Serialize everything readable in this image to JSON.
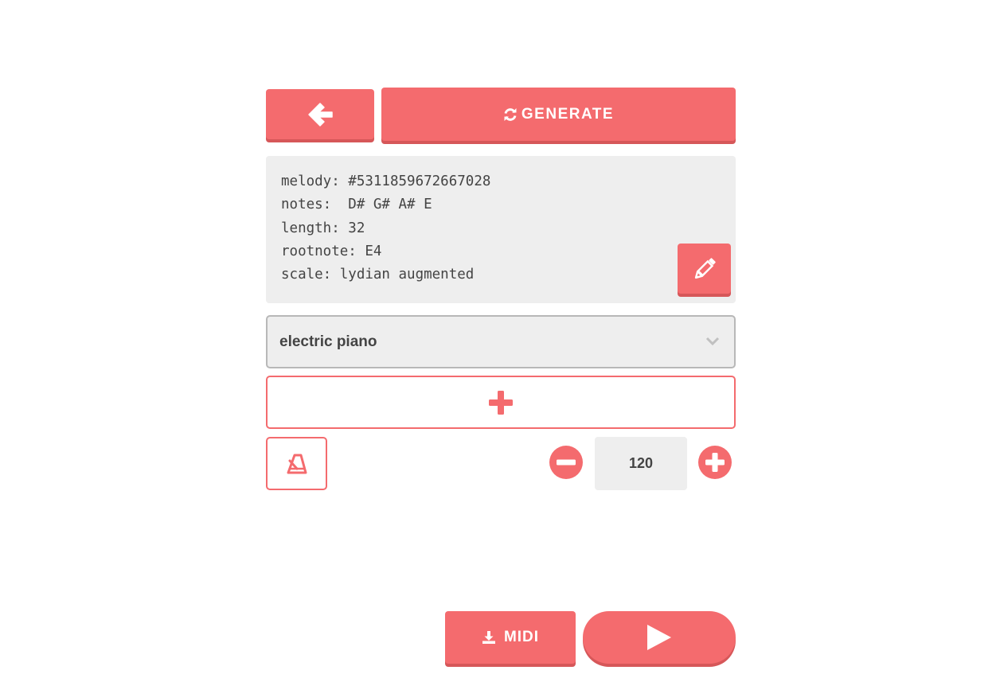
{
  "toolbar": {
    "back_icon": "arrow-left-icon",
    "generate_icon": "refresh-icon",
    "generate_label": "GENERATE"
  },
  "melody_info": {
    "lines": [
      "melody: #5311859672667028",
      "notes:  D# G# A# E",
      "length: 32",
      "rootnote: E4",
      "scale: lydian augmented"
    ],
    "edit_icon": "pencil-icon"
  },
  "instrument": {
    "selected": "electric piano",
    "chevron_icon": "chevron-down-icon"
  },
  "add_track": {
    "icon": "plus-icon"
  },
  "tempo": {
    "metronome_icon": "metronome-icon",
    "decrease_icon": "minus-circle-icon",
    "value": "120",
    "increase_icon": "plus-circle-icon"
  },
  "footer": {
    "midi_icon": "download-icon",
    "midi_label": "MIDI",
    "play_icon": "play-icon"
  },
  "colors": {
    "accent": "#f46b6e",
    "accent_shadow": "#d65759",
    "panel_bg": "#eeeeee",
    "text": "#444444"
  }
}
